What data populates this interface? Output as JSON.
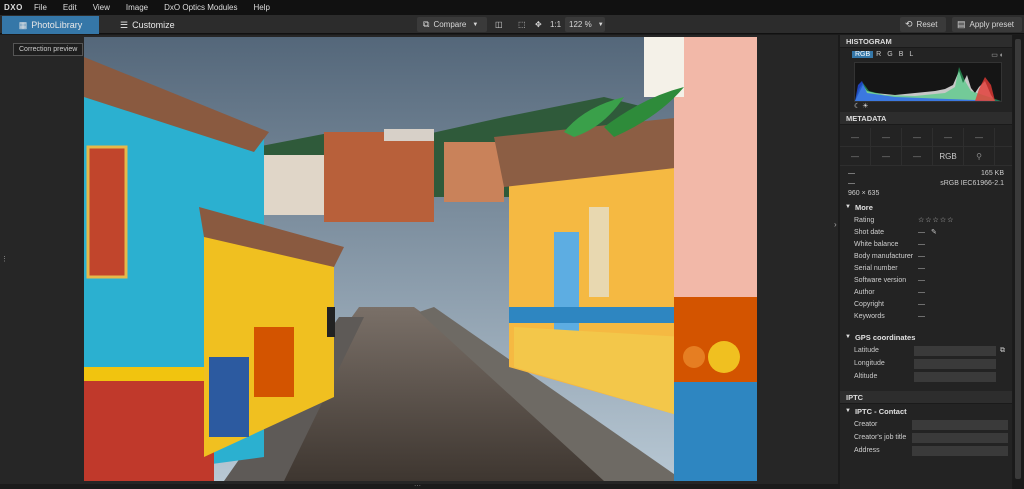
{
  "app": {
    "logo": "DXO"
  },
  "menu": [
    "File",
    "Edit",
    "View",
    "Image",
    "DxO Optics Modules",
    "Help"
  ],
  "tabs": {
    "photolibrary": "PhotoLibrary",
    "customize": "Customize"
  },
  "toolbar": {
    "compare": "Compare",
    "one_to_one": "1:1",
    "zoom": "122 %",
    "reset": "Reset",
    "apply_preset": "Apply preset"
  },
  "viewer": {
    "preview_label": "Correction preview"
  },
  "histogram": {
    "title": "HISTOGRAM",
    "channels": [
      "RGB",
      "R",
      "G",
      "B",
      "L"
    ],
    "active_channel": "RGB"
  },
  "metadata": {
    "title": "METADATA",
    "grid_row1": [
      "—",
      "—",
      "—",
      "—",
      "—"
    ],
    "grid_row2": [
      "—",
      "—",
      "—",
      "RGB",
      ""
    ],
    "file_size_left": "—",
    "file_size": "165 KB",
    "color_left": "—",
    "color_profile": "sRGB IEC61966-2.1",
    "dimensions": "960 × 635",
    "more_title": "More",
    "rows": [
      {
        "key": "Rating",
        "value": "☆☆☆☆☆"
      },
      {
        "key": "Shot date",
        "value": "—"
      },
      {
        "key": "White balance",
        "value": "—"
      },
      {
        "key": "Body manufacturer",
        "value": "—"
      },
      {
        "key": "Serial number",
        "value": "—"
      },
      {
        "key": "Software version",
        "value": "—"
      },
      {
        "key": "Author",
        "value": "—"
      },
      {
        "key": "Copyright",
        "value": "—"
      },
      {
        "key": "Keywords",
        "value": "—"
      }
    ],
    "gps_title": "GPS coordinates",
    "gps": [
      "Latitude",
      "Longitude",
      "Altitude"
    ]
  },
  "iptc": {
    "title": "IPTC",
    "contact_title": "IPTC - Contact",
    "fields": [
      "Creator",
      "Creator's job title",
      "Address"
    ]
  },
  "colors": {
    "accent": "#3577a8",
    "panel": "#232323",
    "bg": "#262626"
  }
}
